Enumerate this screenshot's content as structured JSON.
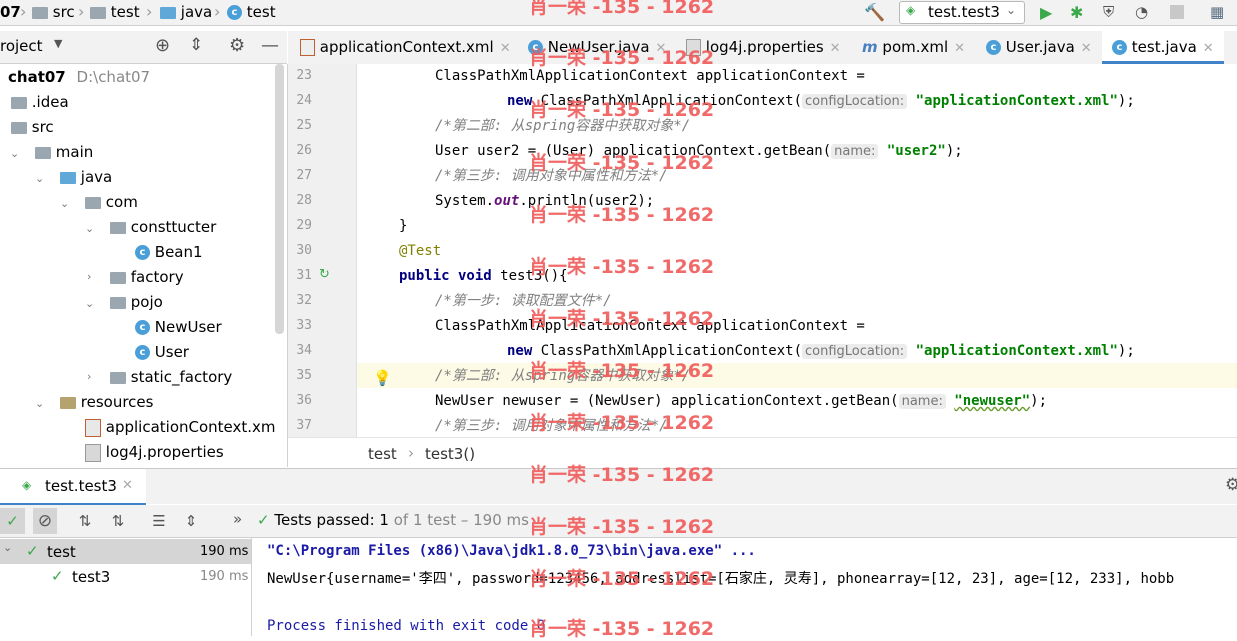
{
  "navbar": {
    "crumbs": [
      "07",
      "src",
      "test",
      "java",
      "test"
    ],
    "run_config": "test.test3"
  },
  "project": {
    "title": "roject",
    "root_name": "chat07",
    "root_path": "D:\\chat07",
    "items": [
      "chat07",
      ".idea",
      "src",
      "main",
      "java",
      "com",
      "consttucter",
      "Bean1",
      "factory",
      "pojo",
      "NewUser",
      "User",
      "static_factory",
      "resources",
      "applicationContext.xm",
      "log4j.properties"
    ]
  },
  "tabs": [
    "applicationContext.xml",
    "NewUser.java",
    "log4j.properties",
    "pom.xml",
    "User.java",
    "test.java"
  ],
  "editor": {
    "line_numbers": [
      "23",
      "24",
      "25",
      "26",
      "27",
      "28",
      "29",
      "30",
      "31",
      "32",
      "33",
      "34",
      "35",
      "36",
      "37"
    ],
    "l23": "ClassPathXmlApplicationContext applicationContext =",
    "l24_kw": "new",
    "l24_a": " ClassPathXmlApplicationContext(",
    "l24_hint": "configLocation:",
    "l24_str": "\"applicationContext.xml\"",
    "l24_b": ");",
    "l25": "/*第二部: 从spring容器中获取对象*/",
    "l26_a": "User user2 = (User) applicationContext.getBean(",
    "l26_hint": "name:",
    "l26_str": "\"user2\"",
    "l26_b": ");",
    "l27": "/*第三步: 调用对象中属性和方法*/",
    "l28_a": "System.",
    "l28_fld": "out",
    "l28_b": ".println(user2);",
    "l29": "}",
    "l30": "@Test",
    "l31_kw": "public void",
    "l31_a": " test3(){",
    "l32": "/*第一步: 读取配置文件*/",
    "l33": "ClassPathXmlApplicationContext applicationContext =",
    "l34_kw": "new",
    "l34_a": " ClassPathXmlApplicationContext(",
    "l34_hint": "configLocation:",
    "l34_str": "\"applicationContext.xml\"",
    "l34_b": ");",
    "l35": "/*第二部: 从spring容器中获取对象*/",
    "l36_a": "NewUser newuser = (NewUser) applicationContext.getBean(",
    "l36_hint": "name:",
    "l36_str": "\"newuser\"",
    "l36_b": ");",
    "l37": "/*第三步: 调用对象中属性和方法*/"
  },
  "editor_breadcrumb": [
    "test",
    "test3()"
  ],
  "run": {
    "tab_label": "test.test3",
    "status_label": "Tests passed:",
    "status_count": "1",
    "status_detail": "of 1 test – 190 ms",
    "tree": [
      {
        "name": "test",
        "time": "190 ms"
      },
      {
        "name": "test3",
        "time": "190 ms"
      }
    ],
    "console": [
      "\"C:\\Program Files (x86)\\Java\\jdk1.8.0_73\\bin\\java.exe\" ...",
      "NewUser{username='李四', password=123456, addresslist=[石家庄, 灵寿], phonearray=[12, 23], age=[12, 233], hobb",
      "",
      "Process finished with exit code 0"
    ]
  },
  "watermark": "肖一荣 -135 - 1262",
  "colors": {
    "accent": "#4083c9",
    "pass": "#3aa84b",
    "watermark": "#f05a5a"
  }
}
